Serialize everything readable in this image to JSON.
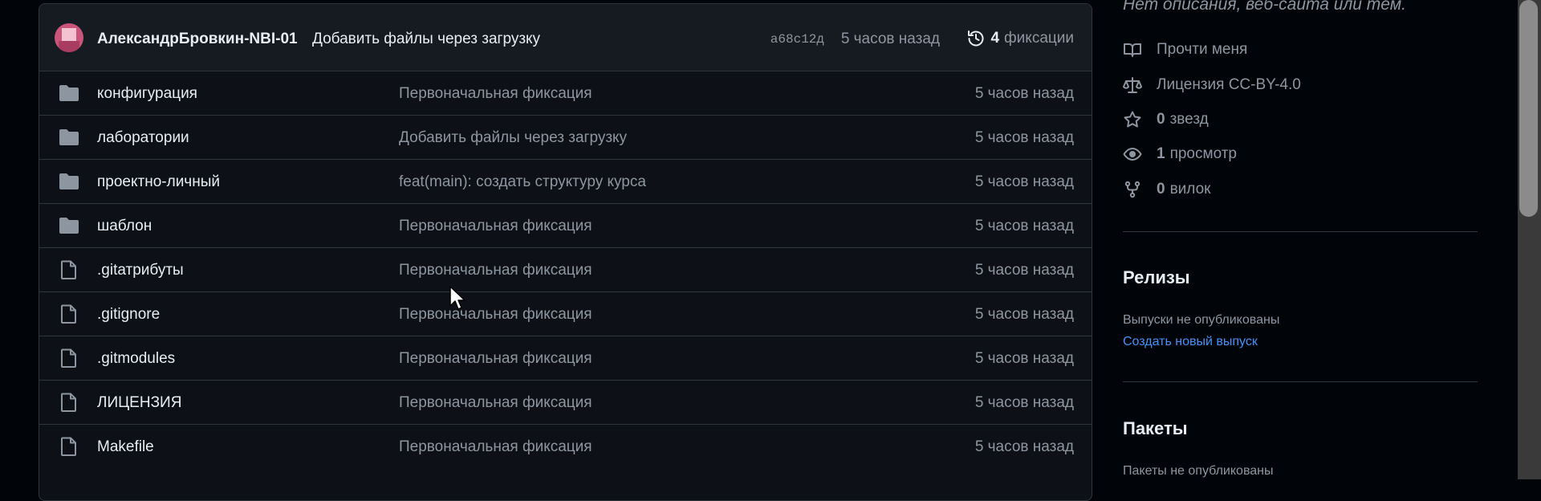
{
  "commit": {
    "author": "АлександрБровкин-NBI-01",
    "message": "Добавить файлы через загрузку",
    "sha": "a68c12д",
    "time": "5 часов назад",
    "history_count": "4",
    "history_label": "фиксации"
  },
  "files": [
    {
      "type": "folder",
      "name": "конфигурация",
      "message": "Первоначальная фиксация",
      "time": "5 часов назад"
    },
    {
      "type": "folder",
      "name": "лаборатории",
      "message": "Добавить файлы через загрузку",
      "time": "5 часов назад"
    },
    {
      "type": "folder",
      "name": "проектно-личный",
      "message": "feat(main): создать структуру курса",
      "time": "5 часов назад"
    },
    {
      "type": "folder",
      "name": "шаблон",
      "message": "Первоначальная фиксация",
      "time": "5 часов назад"
    },
    {
      "type": "file",
      "name": ".gitатрибуты",
      "message": "Первоначальная фиксация",
      "time": "5 часов назад"
    },
    {
      "type": "file",
      "name": ".gitignore",
      "message": "Первоначальная фиксация",
      "time": "5 часов назад"
    },
    {
      "type": "file",
      "name": ".gitmodules",
      "message": "Первоначальная фиксация",
      "time": "5 часов назад"
    },
    {
      "type": "file",
      "name": "ЛИЦЕНЗИЯ",
      "message": "Первоначальная фиксация",
      "time": "5 часов назад"
    },
    {
      "type": "file",
      "name": "Makefile",
      "message": "Первоначальная фиксация",
      "time": "5 часов назад"
    }
  ],
  "sidebar": {
    "description": "Нет описания, веб-сайта или тем.",
    "readme": "Прочти меня",
    "license": "Лицензия CC-BY-4.0",
    "stars_count": "0",
    "stars_label": "звезд",
    "watchers_count": "1",
    "watchers_label": "просмотр",
    "forks_count": "0",
    "forks_label": "вилок",
    "releases_heading": "Релизы",
    "releases_text": "Выпуски не опубликованы",
    "releases_link": "Создать новый выпуск",
    "packages_heading": "Пакеты",
    "packages_text": "Пакеты не опубликованы"
  },
  "colors": {
    "background": "#010409",
    "panel": "#0d1117",
    "border": "#30363d",
    "text": "#e6edf3",
    "muted": "#8d96a0",
    "link": "#4493f8",
    "folder_icon": "#8d96a0"
  },
  "icons": {
    "folder": "folder-icon",
    "file": "file-icon",
    "history": "history-icon",
    "readme": "book-icon",
    "license": "scale-icon",
    "stars": "star-icon",
    "watchers": "eye-icon",
    "forks": "fork-icon"
  }
}
